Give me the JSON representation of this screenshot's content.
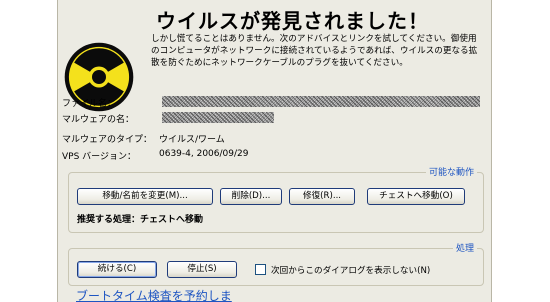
{
  "dialog": {
    "title": "ウイルスが発見されました！",
    "message": "しかし慌てることはありません。次のアドバイスとリンクを試してください。御使用のコンピュータがネットワークに接続されているようであれば、ウイルスの更なる拡散を防ぐためにネットワークケーブルのプラグを抜いてください。",
    "icon": "radiation-icon"
  },
  "info": {
    "file_name_label": "ファイル名：",
    "malware_name_label": "マルウェアの名：",
    "malware_type_label": "マルウェアのタイプ：",
    "malware_type_value": "ウイルス/ワーム",
    "vps_label": "VPS バージョン：",
    "vps_value": "0639-4, 2006/09/29"
  },
  "actions": {
    "legend": "可能な動作",
    "move_rename_button": "移動/名前を変更(M)...",
    "delete_button": "削除(D)...",
    "repair_button": "修復(R)...",
    "chest_button": "チェストへ移動(O)",
    "recommended": "推奨する処理：チェストへ移動"
  },
  "process": {
    "legend": "処理",
    "continue_button": "続ける(C)",
    "stop_button": "停止(S)",
    "dont_show_checkbox": "次回からこのダイアログを表示しない(N)",
    "dont_show_checked": false
  },
  "footer": {
    "boot_scan_link": "ブートタイム検査を予約しま"
  },
  "colors": {
    "dialog_bg": "#ecebe3",
    "accent_blue": "#1e55c2",
    "icon_yellow": "#f4e11c",
    "icon_black": "#000000"
  }
}
